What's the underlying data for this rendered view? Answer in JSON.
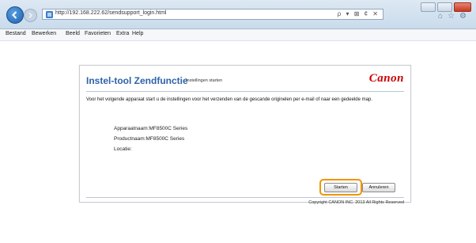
{
  "browser": {
    "url": "http://192.168.222.62/sendsupport_login.html",
    "address_controls": "ρ ▾ ⊠ ¢ ✕",
    "menu": [
      "Bestand",
      "Bewerken",
      "Beeld",
      "Favorieten",
      "Extra",
      "Help"
    ]
  },
  "dialog": {
    "title": "Instel-tool Zendfunctie",
    "subtitle": "Instellingen starten",
    "logo": "Canon",
    "intro": "Voor het volgende apparaat start u de instellingen voor het verzenden van de gescande originelen per e-mail of naar een gedeelde map.",
    "device_name": "Apparaatnaam:MF8500C Series",
    "product_name": "Productnaam:MF8500C Series",
    "location": "Locatie:",
    "start_label": "Starten",
    "cancel_label": "Annuleren",
    "copyright": "Copyright CANON INC. 2013 All Rights Reserved"
  },
  "colors": {
    "accent": "#2e63a8",
    "logo": "#cc0000",
    "highlight": "#f29400"
  }
}
